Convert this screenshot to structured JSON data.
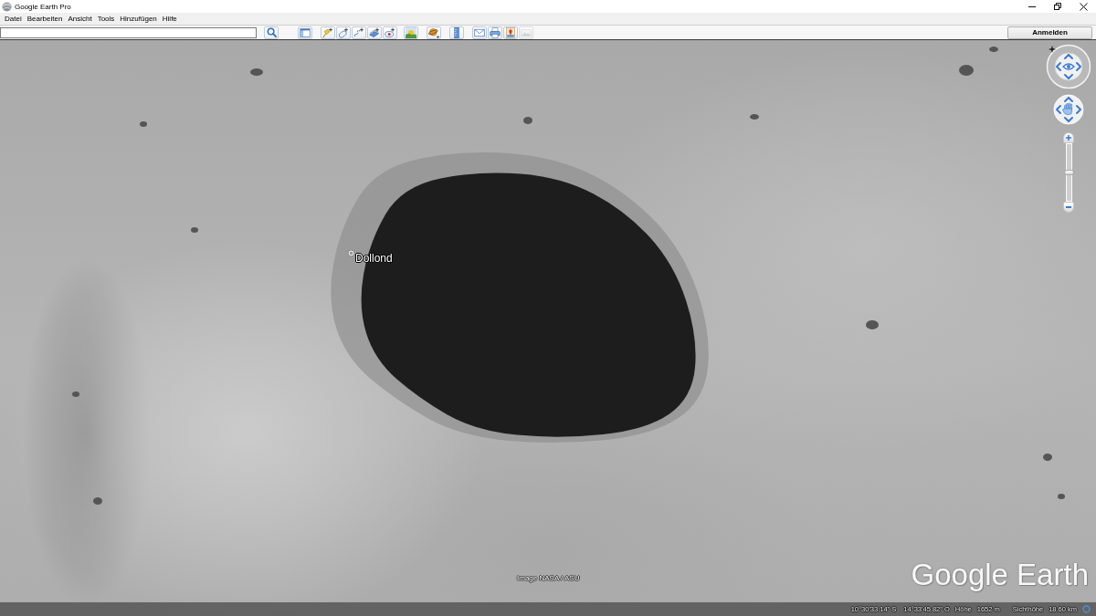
{
  "window": {
    "title": "Google Earth Pro"
  },
  "menu": [
    "Datei",
    "Bearbeiten",
    "Ansicht",
    "Tools",
    "Hinzufügen",
    "Hilfe"
  ],
  "toolbar": {
    "groups": [
      {
        "buttons": [
          {
            "disabled": false
          }
        ]
      },
      {
        "buttons": [
          {
            "disabled": false
          },
          {
            "disabled": false
          },
          {
            "disabled": false
          },
          {
            "disabled": false
          },
          {
            "disabled": false
          }
        ]
      },
      {
        "buttons": [
          {
            "disabled": false
          }
        ]
      },
      {
        "buttons": [
          {
            "disabled": false
          }
        ]
      },
      {
        "buttons": [
          {
            "disabled": false
          }
        ]
      },
      {
        "buttons": [
          {
            "disabled": false
          },
          {
            "disabled": false
          },
          {
            "disabled": false
          },
          {
            "disabled": true
          }
        ]
      }
    ],
    "sign_in_button": "Anmelden"
  },
  "map": {
    "place_labels": [
      {
        "label": "Dollond"
      }
    ],
    "image_credit": "Image NASA / ASU",
    "logo": "Google Earth"
  },
  "navigation": {
    "zoom_slider": {
      "level": 0.5
    }
  },
  "status_bar": {
    "latitude": "10°30'33.14\" S",
    "longitude": "14°33'45.82\" O",
    "elevation_label": "Höhe",
    "elevation": "1652 m",
    "eye_altitude_label": "Sichthöhe",
    "eye_altitude": "18.60 km"
  }
}
